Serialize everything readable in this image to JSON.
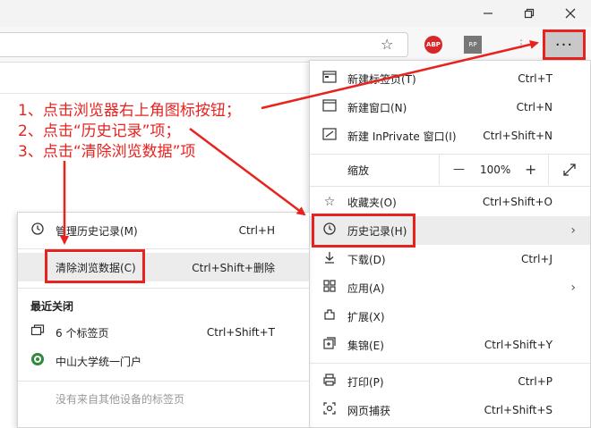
{
  "window": {
    "minimize_icon": "minimize-icon",
    "maximize_icon": "restore-icon",
    "close_icon": "close-icon"
  },
  "toolbar": {
    "favorite_icon": "star-icon",
    "ext_abp_label": "ABP",
    "ext_rp_label": "RP",
    "more_label": "···"
  },
  "annotation": {
    "step1": "1、点击浏览器右上角图标按钮；",
    "step2": "2、点击“历史记录”项；",
    "step3": "3、点击“清除浏览数据”项"
  },
  "menu": {
    "items": [
      {
        "label": "新建标签页(T)",
        "shortcut": "Ctrl+T",
        "icon": "new-tab-icon"
      },
      {
        "label": "新建窗口(N)",
        "shortcut": "Ctrl+N",
        "icon": "new-window-icon"
      },
      {
        "label": "新建 InPrivate 窗口(I)",
        "shortcut": "Ctrl+Shift+N",
        "icon": "inprivate-icon"
      },
      {
        "label": "缩放",
        "shortcut": "",
        "icon": ""
      },
      {
        "label": "收藏夹(O)",
        "shortcut": "Ctrl+Shift+O",
        "icon": "favorites-icon"
      },
      {
        "label": "历史记录(H)",
        "shortcut": "",
        "icon": "history-icon"
      },
      {
        "label": "下载(D)",
        "shortcut": "Ctrl+J",
        "icon": "download-icon"
      },
      {
        "label": "应用(A)",
        "shortcut": "",
        "icon": "apps-icon"
      },
      {
        "label": "扩展(X)",
        "shortcut": "",
        "icon": "extensions-icon"
      },
      {
        "label": "集锦(E)",
        "shortcut": "Ctrl+Shift+Y",
        "icon": "collections-icon"
      },
      {
        "label": "打印(P)",
        "shortcut": "Ctrl+P",
        "icon": "print-icon"
      },
      {
        "label": "网页捕获",
        "shortcut": "Ctrl+Shift+S",
        "icon": "capture-icon"
      }
    ],
    "zoom": {
      "minus": "—",
      "value": "100%",
      "plus": "+"
    }
  },
  "history_submenu": {
    "manage": {
      "label": "管理历史记录(M)",
      "shortcut": "Ctrl+H"
    },
    "clear": {
      "label": "清除浏览数据(C)",
      "shortcut": "Ctrl+Shift+删除"
    },
    "recently_closed": "最近关闭",
    "tabs": {
      "label": "6 个标签页",
      "shortcut": "Ctrl+Shift+T"
    },
    "site": {
      "label": "中山大学统一门户"
    },
    "footer": "没有来自其他设备的标签页"
  },
  "colors": {
    "annotation": "#e8221f",
    "highlight": "#ececec"
  }
}
